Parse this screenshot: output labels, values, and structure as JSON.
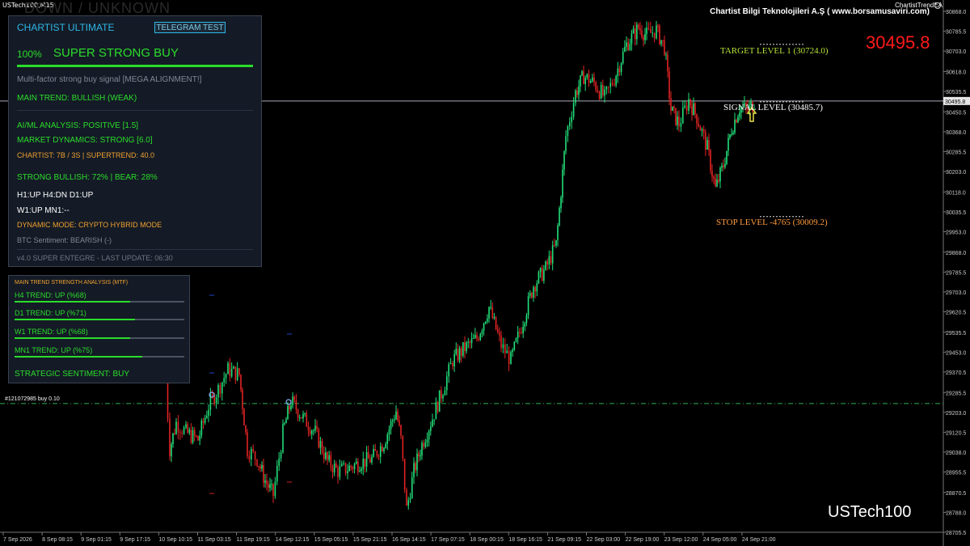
{
  "window": {
    "symbol_title": "USTech100,M15",
    "ea_name": "ChartistTrendEA",
    "company": "Chartist Bilgi Teknolojileri A.Ş ( www.borsamusaviri.com)",
    "ghost_text": "DOWN / UNKNOWN",
    "big_price": "30495.8",
    "bottom_symbol": "USTech100",
    "trade_ticket": "#121072985 buy 0.10"
  },
  "levels": {
    "target": "TARGET LEVEL 1 (30724.0)",
    "signal": "SIGNAL LEVEL (30485.7)",
    "stop": "STOP LEVEL -4765 (30009.2)",
    "current_price_tag": "30495.8"
  },
  "panel_main": {
    "header": "CHARTIST ULTIMATE",
    "telegram_button": "TELEGRAM TEST",
    "percent": "100%",
    "signal": "SUPER STRONG BUY",
    "description": "Multi-factor strong buy signal [MEGA ALIGNMENT!]",
    "main_trend": "MAIN TREND: BULLISH (WEAK)",
    "ai_ml": "AI/ML ANALYSIS: POSITIVE [1.5]",
    "market_dynamics": "MARKET DYNAMICS: STRONG [6.0]",
    "chartist": "CHARTIST: 7B / 3S | SUPERTREND: 40.0",
    "strong_bullish": "STRONG BULLISH: 72% | BEAR: 28%",
    "tf_line1": "H1:UP H4:DN D1:UP",
    "tf_line2": "W1:UP MN1:--",
    "dynamic_mode": "DYNAMIC MODE: CRYPTO HYBRID MODE",
    "btc_sentiment": "BTC Sentiment: BEARISH (-)",
    "version": "v4.0 SUPER ENTEGRE - LAST UPDATE: 06:30"
  },
  "panel_mtf": {
    "header": "MAIN TREND STRENGTH ANALYSIS (MTF)",
    "rows": [
      {
        "label": "H4 TREND: UP (%68)",
        "strength": 0.68
      },
      {
        "label": "D1 TREND: UP (%71)",
        "strength": 0.71
      },
      {
        "label": "W1 TREND: UP (%68)",
        "strength": 0.68
      },
      {
        "label": "MN1 TREND: UP (%75)",
        "strength": 0.75
      }
    ],
    "strategic": "STRATEGIC SENTIMENT: BUY"
  },
  "colors": {
    "bull": "#22e07a",
    "bear": "#e02424",
    "accent": "#2fb7e8",
    "signal_green": "#2bdc2b",
    "orange": "#f0a030",
    "target": "#b7e33a",
    "price_red": "#ff1a1a"
  },
  "chart_data": {
    "type": "candlestick",
    "y_ticks": [
      "30868.0",
      "30785.5",
      "30703.0",
      "30618.0",
      "30535.5",
      "30450.5",
      "30368.0",
      "30285.5",
      "30203.0",
      "30118.0",
      "30035.5",
      "29953.0",
      "29868.0",
      "29785.5",
      "29703.0",
      "29620.5",
      "29535.5",
      "29453.0",
      "29370.5",
      "29285.5",
      "29203.0",
      "29120.5",
      "29038.0",
      "28955.5",
      "28870.5",
      "28788.0",
      "28705.5"
    ],
    "x_ticks": [
      "7 Sep 2026",
      "8 Sep 08:15",
      "9 Sep 01:15",
      "9 Sep 17:15",
      "10 Sep 10:15",
      "11 Sep 03:15",
      "11 Sep 19:15",
      "14 Sep 12:15",
      "15 Sep 05:15",
      "15 Sep 21:15",
      "16 Sep 14:15",
      "17 Sep 07:15",
      "18 Sep 00:15",
      "18 Sep 16:15",
      "21 Sep 09:15",
      "22 Sep 03:00",
      "22 Sep 19:00",
      "23 Sep 12:00",
      "24 Sep 05:00",
      "24 Sep 21:00"
    ],
    "ylim": [
      28705.5,
      30868.0
    ],
    "current_price": 30495.8,
    "target_price": 30724.0,
    "signal_price": 30485.7,
    "stop_price": 30009.2,
    "trade_price": 29240.0,
    "price_path": [
      [
        205,
        29340
      ],
      [
        210,
        29050
      ],
      [
        218,
        29160
      ],
      [
        230,
        29120
      ],
      [
        245,
        29090
      ],
      [
        258,
        29230
      ],
      [
        270,
        29300
      ],
      [
        282,
        29380
      ],
      [
        296,
        29360
      ],
      [
        306,
        29050
      ],
      [
        318,
        29010
      ],
      [
        328,
        28920
      ],
      [
        338,
        28860
      ],
      [
        350,
        29120
      ],
      [
        360,
        29250
      ],
      [
        375,
        29180
      ],
      [
        390,
        29120
      ],
      [
        405,
        29000
      ],
      [
        418,
        28960
      ],
      [
        430,
        28970
      ],
      [
        445,
        28995
      ],
      [
        460,
        29010
      ],
      [
        475,
        29080
      ],
      [
        490,
        29210
      ],
      [
        496,
        29090
      ],
      [
        503,
        28800
      ],
      [
        512,
        28960
      ],
      [
        522,
        29070
      ],
      [
        535,
        29180
      ],
      [
        548,
        29300
      ],
      [
        560,
        29420
      ],
      [
        575,
        29470
      ],
      [
        590,
        29510
      ],
      [
        605,
        29640
      ],
      [
        620,
        29480
      ],
      [
        632,
        29420
      ],
      [
        645,
        29560
      ],
      [
        660,
        29730
      ],
      [
        675,
        29800
      ],
      [
        688,
        29900
      ],
      [
        694,
        30120
      ],
      [
        700,
        30350
      ],
      [
        712,
        30530
      ],
      [
        722,
        30600
      ],
      [
        735,
        30570
      ],
      [
        748,
        30510
      ],
      [
        760,
        30590
      ],
      [
        775,
        30730
      ],
      [
        790,
        30800
      ],
      [
        800,
        30770
      ],
      [
        812,
        30790
      ],
      [
        822,
        30720
      ],
      [
        830,
        30460
      ],
      [
        840,
        30400
      ],
      [
        852,
        30500
      ],
      [
        862,
        30430
      ],
      [
        875,
        30300
      ],
      [
        885,
        30130
      ],
      [
        895,
        30230
      ],
      [
        905,
        30380
      ],
      [
        915,
        30470
      ],
      [
        925,
        30460
      ],
      [
        935,
        30495
      ]
    ]
  }
}
